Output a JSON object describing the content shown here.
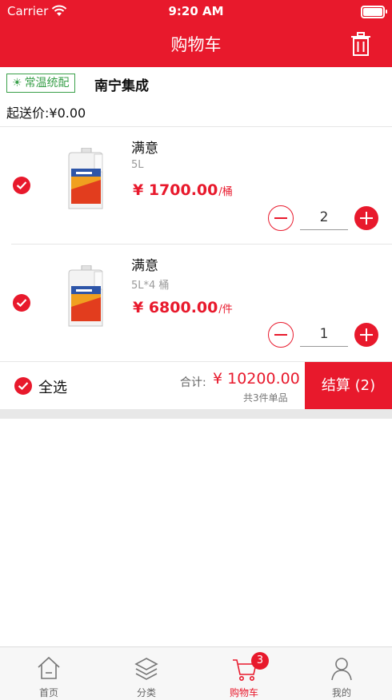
{
  "status_bar": {
    "carrier": "Carrier",
    "time": "9:20 AM"
  },
  "nav": {
    "title": "购物车",
    "trash_icon": "trash-icon"
  },
  "store": {
    "badge": "常温统配",
    "badge_icon": "sun-icon",
    "name": "南宁集成",
    "minimum_order": "起送价:¥0.00"
  },
  "items": [
    {
      "name": "满意",
      "spec": "5L",
      "price": "¥ 1700.00",
      "unit": "/桶",
      "quantity": "2",
      "checked": true
    },
    {
      "name": "满意",
      "spec": "5L*4 桶",
      "price": "¥ 6800.00",
      "unit": "/件",
      "quantity": "1",
      "checked": true
    }
  ],
  "footer": {
    "select_all": "全选",
    "total_label": "合计:",
    "total_value": "¥ 10200.00",
    "total_count": "共3件单品",
    "checkout": "结算 (2)"
  },
  "tabbar": {
    "tabs": [
      {
        "label": "首页",
        "icon": "home-icon"
      },
      {
        "label": "分类",
        "icon": "layers-icon"
      },
      {
        "label": "购物车",
        "icon": "cart-icon",
        "badge": "3",
        "active": true
      },
      {
        "label": "我的",
        "icon": "user-icon"
      }
    ]
  },
  "colors": {
    "accent": "#e8192c",
    "badge_green": "#3aa04a"
  }
}
